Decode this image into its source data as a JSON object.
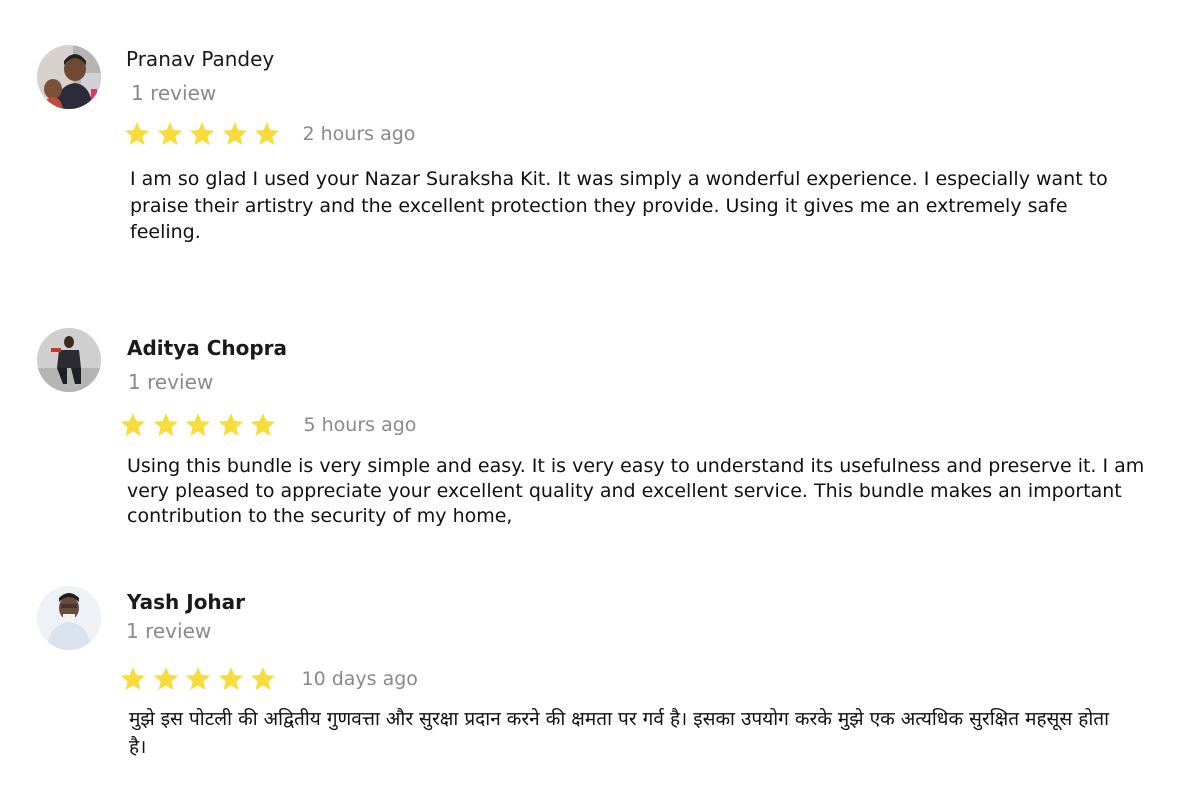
{
  "reviews": [
    {
      "name": "Pranav Pandey",
      "count": "1 review",
      "rating": 5,
      "time": "2 hours ago",
      "text": "I am so glad I used your Nazar Suraksha Kit. It was simply a wonderful experience. I especially want to praise their artistry and the excellent protection they provide. Using it gives me an extremely safe feeling."
    },
    {
      "name": "Aditya Chopra",
      "count": "1 review",
      "rating": 5,
      "time": "5 hours ago",
      "text": "Using this bundle is very simple and easy. It is very easy to understand its usefulness and preserve it. I am very pleased to appreciate your excellent quality and excellent service. This bundle makes an important contribution to the security of my home,"
    },
    {
      "name": "Yash Johar",
      "count": "1 review",
      "rating": 5,
      "time": "10 days ago",
      "text": "मुझे इस पोटली की अद्वितीय गुणवत्ता और सुरक्षा प्रदान करने की क्षमता पर गर्व है। इसका उपयोग करके मुझे एक अत्यधिक सुरक्षित महसूस होता है।"
    }
  ],
  "colors": {
    "star": "#f7dc3c",
    "meta": "#8a8a8a"
  },
  "icons": {
    "star": "star-icon"
  }
}
